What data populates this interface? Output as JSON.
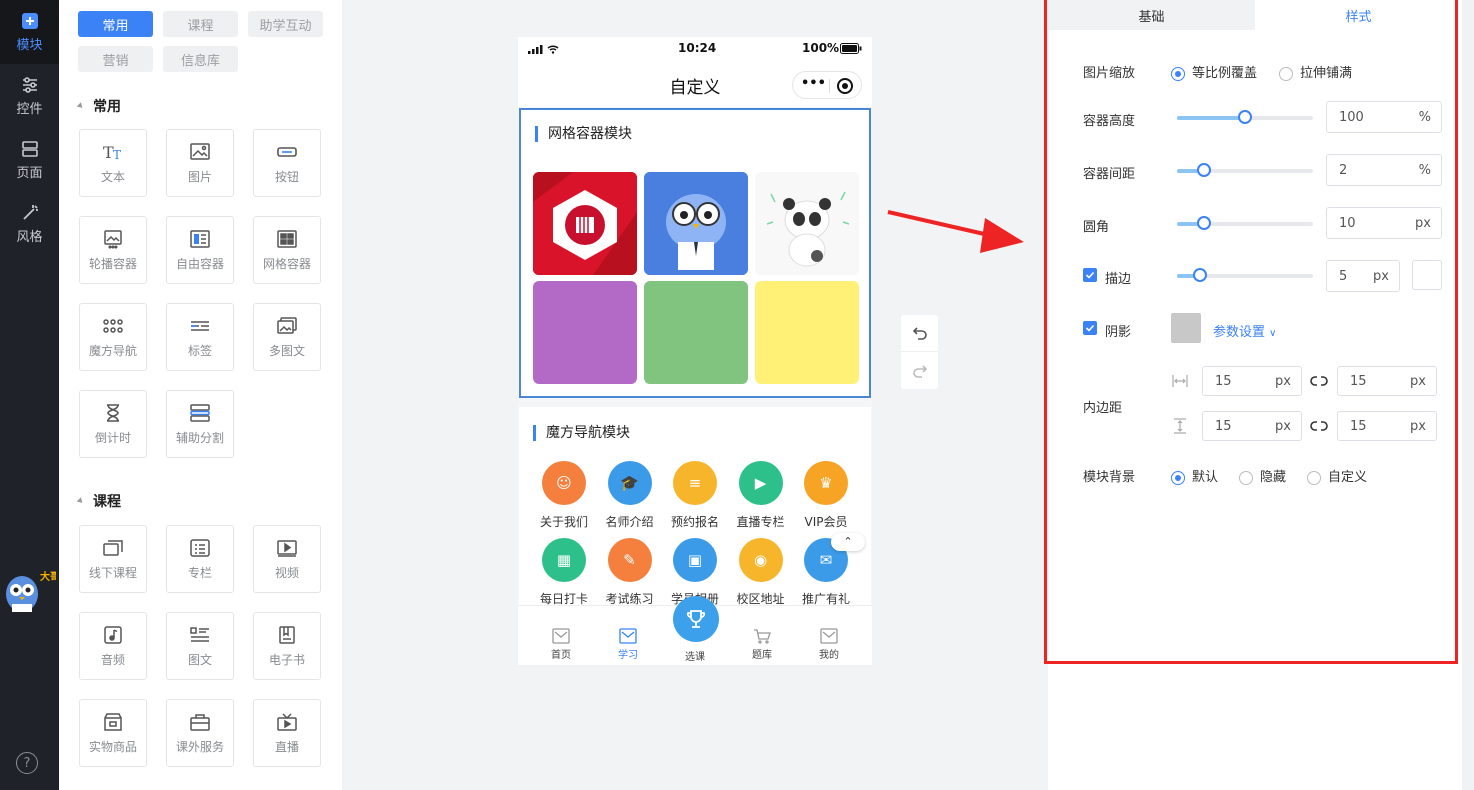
{
  "rail": {
    "items": [
      {
        "label": "模块",
        "icon": "plus-icon"
      },
      {
        "label": "控件",
        "icon": "sliders-icon"
      },
      {
        "label": "页面",
        "icon": "pages-icon"
      },
      {
        "label": "风格",
        "icon": "magic-wand-icon"
      }
    ],
    "mascot_text": "大哥大",
    "help": "?"
  },
  "palette": {
    "tabs": [
      {
        "label": "常用"
      },
      {
        "label": "课程"
      },
      {
        "label": "助学互动"
      },
      {
        "label": "营销"
      },
      {
        "label": "信息库"
      }
    ],
    "sections": [
      {
        "title": "常用",
        "items": [
          {
            "label": "文本",
            "icon": "text-icon"
          },
          {
            "label": "图片",
            "icon": "image-icon"
          },
          {
            "label": "按钮",
            "icon": "button-icon"
          },
          {
            "label": "轮播容器",
            "icon": "carousel-icon"
          },
          {
            "label": "自由容器",
            "icon": "free-container-icon"
          },
          {
            "label": "网格容器",
            "icon": "grid-container-icon"
          },
          {
            "label": "魔方导航",
            "icon": "cube-nav-icon"
          },
          {
            "label": "标签",
            "icon": "tag-icon"
          },
          {
            "label": "多图文",
            "icon": "multi-image-text-icon"
          },
          {
            "label": "倒计时",
            "icon": "hourglass-icon"
          },
          {
            "label": "辅助分割",
            "icon": "divider-icon"
          }
        ]
      },
      {
        "title": "课程",
        "items": [
          {
            "label": "线下课程",
            "icon": "offline-course-icon"
          },
          {
            "label": "专栏",
            "icon": "column-icon"
          },
          {
            "label": "视频",
            "icon": "video-icon"
          },
          {
            "label": "音频",
            "icon": "audio-icon"
          },
          {
            "label": "图文",
            "icon": "image-text-icon"
          },
          {
            "label": "电子书",
            "icon": "ebook-icon"
          },
          {
            "label": "实物商品",
            "icon": "product-icon"
          },
          {
            "label": "课外服务",
            "icon": "service-icon"
          },
          {
            "label": "直播",
            "icon": "live-icon"
          }
        ]
      }
    ]
  },
  "phone": {
    "status": {
      "time": "10:24",
      "battery": "100%"
    },
    "title": "自定义",
    "capsule_dots": "•••",
    "grid_module": {
      "title": "网格容器模块",
      "cells": [
        {
          "color": "#c8102e",
          "kind": "red-logo"
        },
        {
          "color": "#4a7fe0",
          "kind": "owl"
        },
        {
          "color": "#f7f7f7",
          "kind": "panda"
        },
        {
          "color": "#b369c6",
          "kind": "plain"
        },
        {
          "color": "#80c47f",
          "kind": "plain"
        },
        {
          "color": "#fff176",
          "kind": "plain"
        }
      ]
    },
    "cube_module": {
      "title": "魔方导航模块",
      "items": [
        {
          "label": "关于我们",
          "color": "#f5803e",
          "icon": "smile-icon"
        },
        {
          "label": "名师介绍",
          "color": "#3c9be8",
          "icon": "graduation-cap-icon"
        },
        {
          "label": "预约报名",
          "color": "#f7b52c",
          "icon": "database-icon"
        },
        {
          "label": "直播专栏",
          "color": "#2ec08b",
          "icon": "play-icon"
        },
        {
          "label": "VIP会员",
          "color": "#f7a323",
          "icon": "vip-icon"
        },
        {
          "label": "每日打卡",
          "color": "#2ec08b",
          "icon": "calendar-icon"
        },
        {
          "label": "考试练习",
          "color": "#f5803e",
          "icon": "pencil-icon"
        },
        {
          "label": "学员相册",
          "color": "#3c9be8",
          "icon": "album-icon"
        },
        {
          "label": "校区地址",
          "color": "#f7b52c",
          "icon": "location-icon"
        },
        {
          "label": "推广有礼",
          "color": "#3c9be8",
          "icon": "megaphone-icon"
        }
      ]
    },
    "tabbar": [
      {
        "label": "首页"
      },
      {
        "label": "学习",
        "active": true
      },
      {
        "label": "选课",
        "center": true
      },
      {
        "label": "题库"
      },
      {
        "label": "我的"
      }
    ]
  },
  "props": {
    "tabs": [
      {
        "label": "基础"
      },
      {
        "label": "样式"
      }
    ],
    "image_scale": {
      "label": "图片缩放",
      "options": [
        "等比例覆盖",
        "拉伸铺满"
      ],
      "selected": 0
    },
    "container_height": {
      "label": "容器高度",
      "value": "100",
      "unit": "%",
      "level": 0.5
    },
    "container_gap": {
      "label": "容器间距",
      "value": "2",
      "unit": "%",
      "level": 0.2
    },
    "radius": {
      "label": "圆角",
      "value": "10",
      "unit": "px",
      "level": 0.2
    },
    "stroke": {
      "label": "描边",
      "checked": true,
      "value": "5",
      "unit": "px",
      "level": 0.17
    },
    "shadow": {
      "label": "阴影",
      "checked": true,
      "swatch": "#c8c8c8",
      "link": "参数设置"
    },
    "padding": {
      "label": "内边距",
      "h1": "15",
      "h2": "15",
      "v1": "15",
      "v2": "15",
      "unit": "px"
    },
    "module_bg": {
      "label": "模块背景",
      "options": [
        "默认",
        "隐藏",
        "自定义"
      ],
      "selected": 0
    },
    "accent": "#3b82f6",
    "highlight": "#ee2323"
  }
}
